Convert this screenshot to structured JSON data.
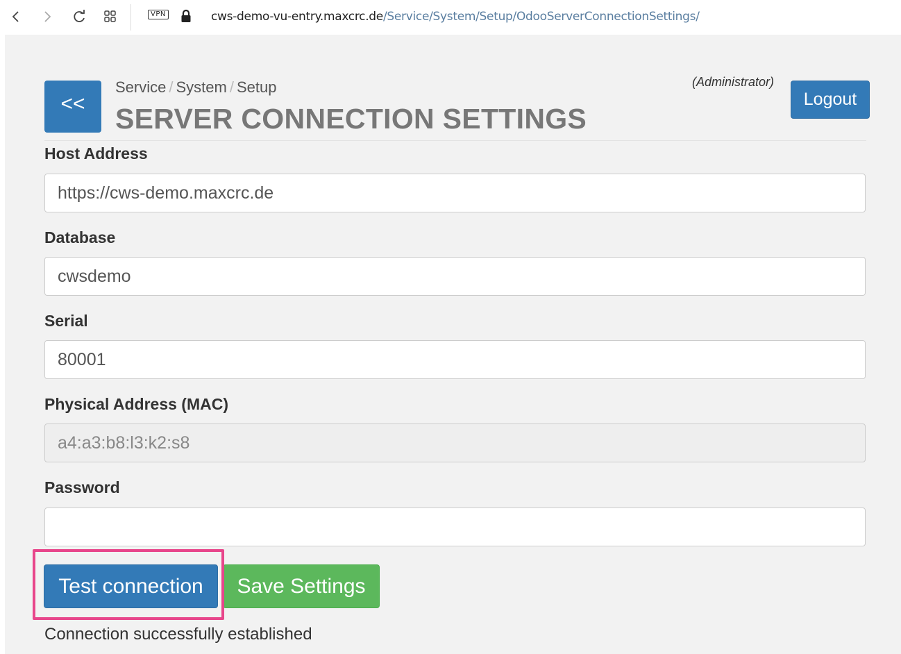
{
  "browser": {
    "vpn_label": "VPN",
    "url_domain": "cws-demo-vu-entry.maxcrc.de",
    "url_path": "/Service/System/Setup/OdooServerConnectionSettings/",
    "back_icon": "chevron-left-icon",
    "forward_icon": "chevron-right-icon",
    "reload_icon": "reload-icon",
    "grid_icon": "grid-icon",
    "lock_icon": "lock-icon"
  },
  "header": {
    "back_label": "<<",
    "breadcrumb": [
      "Service",
      "System",
      "Setup"
    ],
    "breadcrumb_separator": "/",
    "title": "SERVER CONNECTION SETTINGS",
    "role": "(Administrator)",
    "logout_label": "Logout"
  },
  "form": {
    "host": {
      "label": "Host Address",
      "value": "https://cws-demo.maxcrc.de"
    },
    "database": {
      "label": "Database",
      "value": "cwsdemo"
    },
    "serial": {
      "label": "Serial",
      "value": "80001"
    },
    "mac": {
      "label": "Physical Address (MAC)",
      "value": "a4:a3:b8:l3:k2:s8"
    },
    "password": {
      "label": "Password",
      "value": ""
    }
  },
  "actions": {
    "test_label": "Test connection",
    "save_label": "Save Settings"
  },
  "status": {
    "message": "Connection successfully established"
  },
  "colors": {
    "primary": "#337ab7",
    "success": "#5cb85c",
    "highlight": "#e8468b"
  }
}
